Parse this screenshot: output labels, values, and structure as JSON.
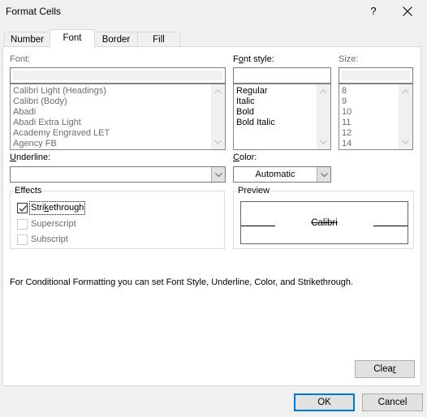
{
  "window": {
    "title": "Format Cells",
    "help_label": "?",
    "close_icon": "close-icon"
  },
  "tabs": [
    {
      "label": "Number",
      "active": false
    },
    {
      "label": "Font",
      "active": true
    },
    {
      "label": "Border",
      "active": false
    },
    {
      "label": "Fill",
      "active": false
    }
  ],
  "font": {
    "label": "Font:",
    "input_value": "",
    "items": [
      "Calibri Light (Headings)",
      "Calibri (Body)",
      "Abadi",
      "Abadi Extra Light",
      "Academy Engraved LET",
      "Agency FB"
    ],
    "enabled": false
  },
  "font_style": {
    "label_pre": "F",
    "label_u": "o",
    "label_post": "nt style:",
    "input_value": "",
    "items": [
      "Regular",
      "Italic",
      "Bold",
      "Bold Italic"
    ],
    "enabled": true
  },
  "size": {
    "label": "Size:",
    "input_value": "",
    "items": [
      "8",
      "9",
      "10",
      "11",
      "12",
      "14"
    ],
    "enabled": false
  },
  "underline": {
    "label_u": "U",
    "label_post": "nderline:",
    "value": ""
  },
  "color": {
    "label_u": "C",
    "label_post": "olor:",
    "value": "Automatic"
  },
  "effects": {
    "title": "Effects",
    "strikethrough": {
      "label_pre": "Stri",
      "label_u": "k",
      "label_post": "ethrough",
      "checked": true,
      "enabled": true
    },
    "superscript": {
      "label": "Superscript",
      "checked": false,
      "enabled": false
    },
    "subscript": {
      "label": "Subscript",
      "checked": false,
      "enabled": false
    }
  },
  "preview": {
    "title": "Preview",
    "sample_text": "Calibri"
  },
  "info_text": "For Conditional Formatting you can set Font Style, Underline, Color, and Strikethrough.",
  "buttons": {
    "clear_pre": "Clea",
    "clear_u": "r",
    "ok": "OK",
    "cancel": "Cancel"
  },
  "colors": {
    "dialog_bg": "#f0f0f0",
    "panel_bg": "#ffffff",
    "default_button_border": "#0078d7",
    "disabled_text": "#6d6d6d"
  }
}
